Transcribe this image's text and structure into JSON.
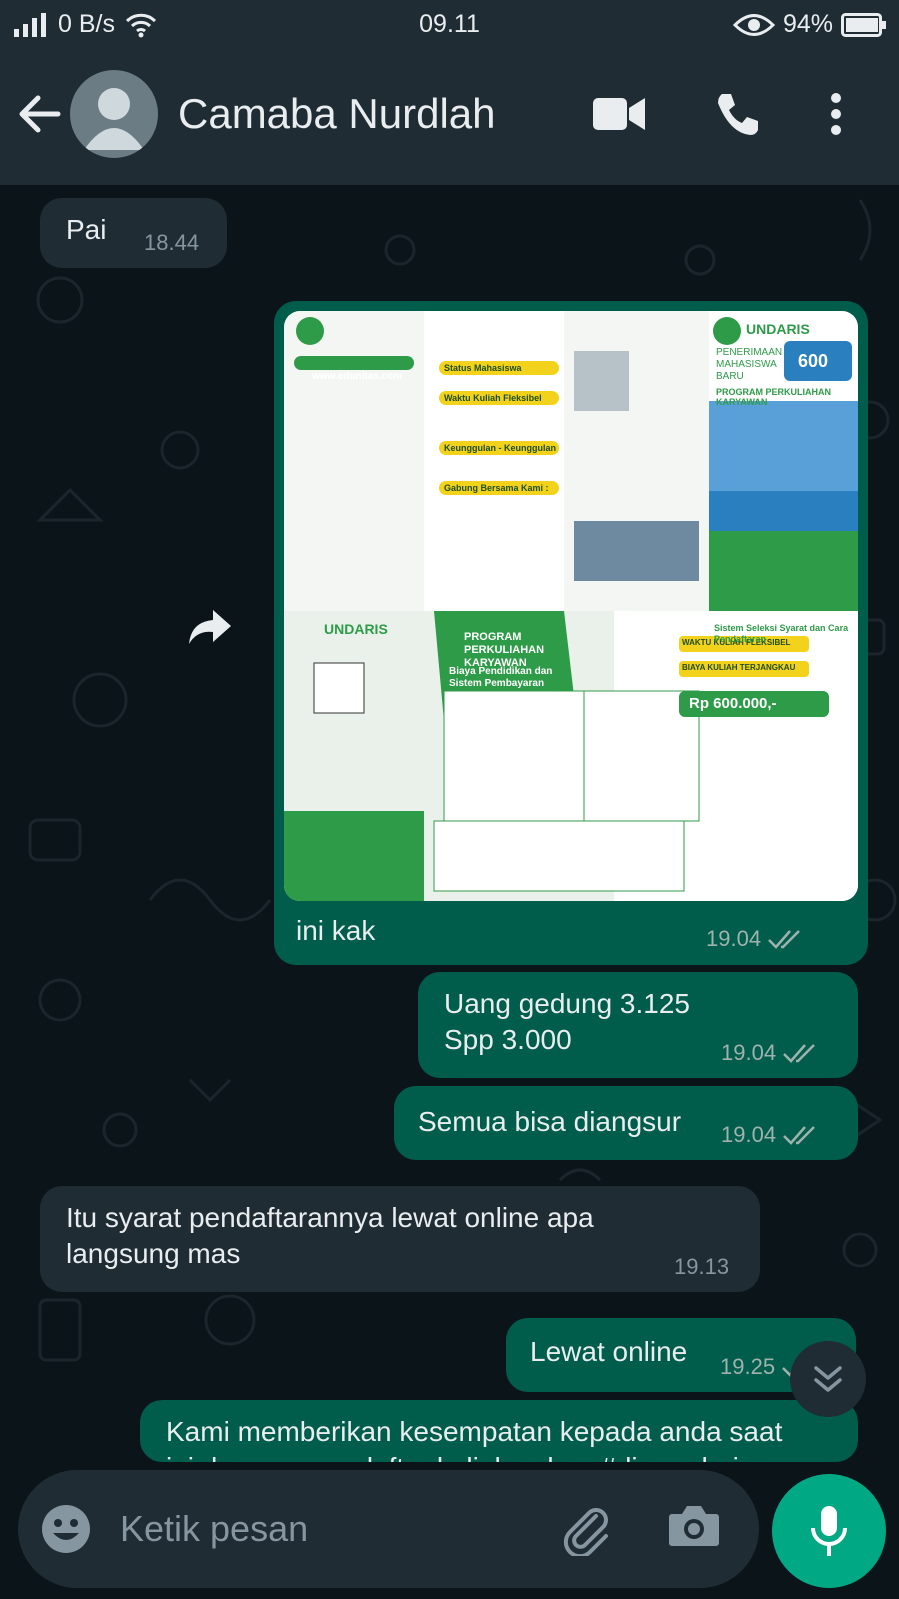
{
  "status_bar": {
    "network": "0 B/s",
    "time": "09.11",
    "battery": "94%"
  },
  "header": {
    "contact_name": "Camaba Nurdlah",
    "icons": [
      "back-arrow-icon",
      "avatar",
      "video-call-icon",
      "voice-call-icon",
      "more-options-icon"
    ]
  },
  "messages": [
    {
      "direction": "in",
      "text": "Pai",
      "time": "18.44"
    },
    {
      "direction": "out",
      "type": "image",
      "caption": "ini kak",
      "time": "19.04",
      "status": "read",
      "image_text": {
        "logo": "UNDARIS",
        "title_right": "PENERIMAAN MAHASISWA BARU",
        "subtitle_right": "PROGRAM PERKULIAHAN KARYAWAN",
        "price_badge": "600",
        "website": "www.edunitas.com",
        "program_banner": "PROGRAM PERKULIAHAN KARYAWAN",
        "cost_heading": "Biaya Pendidikan dan Sistem Pembayaran",
        "total_price": "Rp 600.000,-",
        "waktu": "WAKTU KULIAH FLEKSIBEL",
        "biaya": "BIAYA KULIAH TERJANGKAU",
        "seleksi": "Sistem Seleksi Syarat dan Cara Pendaftaran",
        "status_mhs": "Status Mahasiswa",
        "fleksibel": "Waktu Kuliah Fleksibel",
        "keunggulan": "Keunggulan - Keunggulan",
        "gabung": "Gabung Bersama Kami :"
      }
    },
    {
      "direction": "out",
      "lines": [
        "Uang gedung 3.125",
        "Spp 3.000"
      ],
      "time": "19.04",
      "status": "read"
    },
    {
      "direction": "out",
      "text": "Semua bisa diangsur",
      "time": "19.04",
      "status": "read"
    },
    {
      "direction": "in",
      "lines": [
        "Itu syarat pendaftarannya lewat online apa",
        "langsung mas"
      ],
      "time": "19.13"
    },
    {
      "direction": "out",
      "text": "Lewat online",
      "time": "19.25",
      "status": "read"
    },
    {
      "direction": "out",
      "lines": [
        "Kami memberikan kesempatan kepada anda saat",
        "ini dengan mendaftar kuliah cukup #dirumahaja"
      ]
    }
  ],
  "input": {
    "placeholder": "Ketik pesan"
  },
  "colors": {
    "header": "#1f2c34",
    "outgoing": "#005c4b",
    "incoming": "#1f2c34",
    "accent": "#00a884",
    "background": "#0b1418"
  }
}
